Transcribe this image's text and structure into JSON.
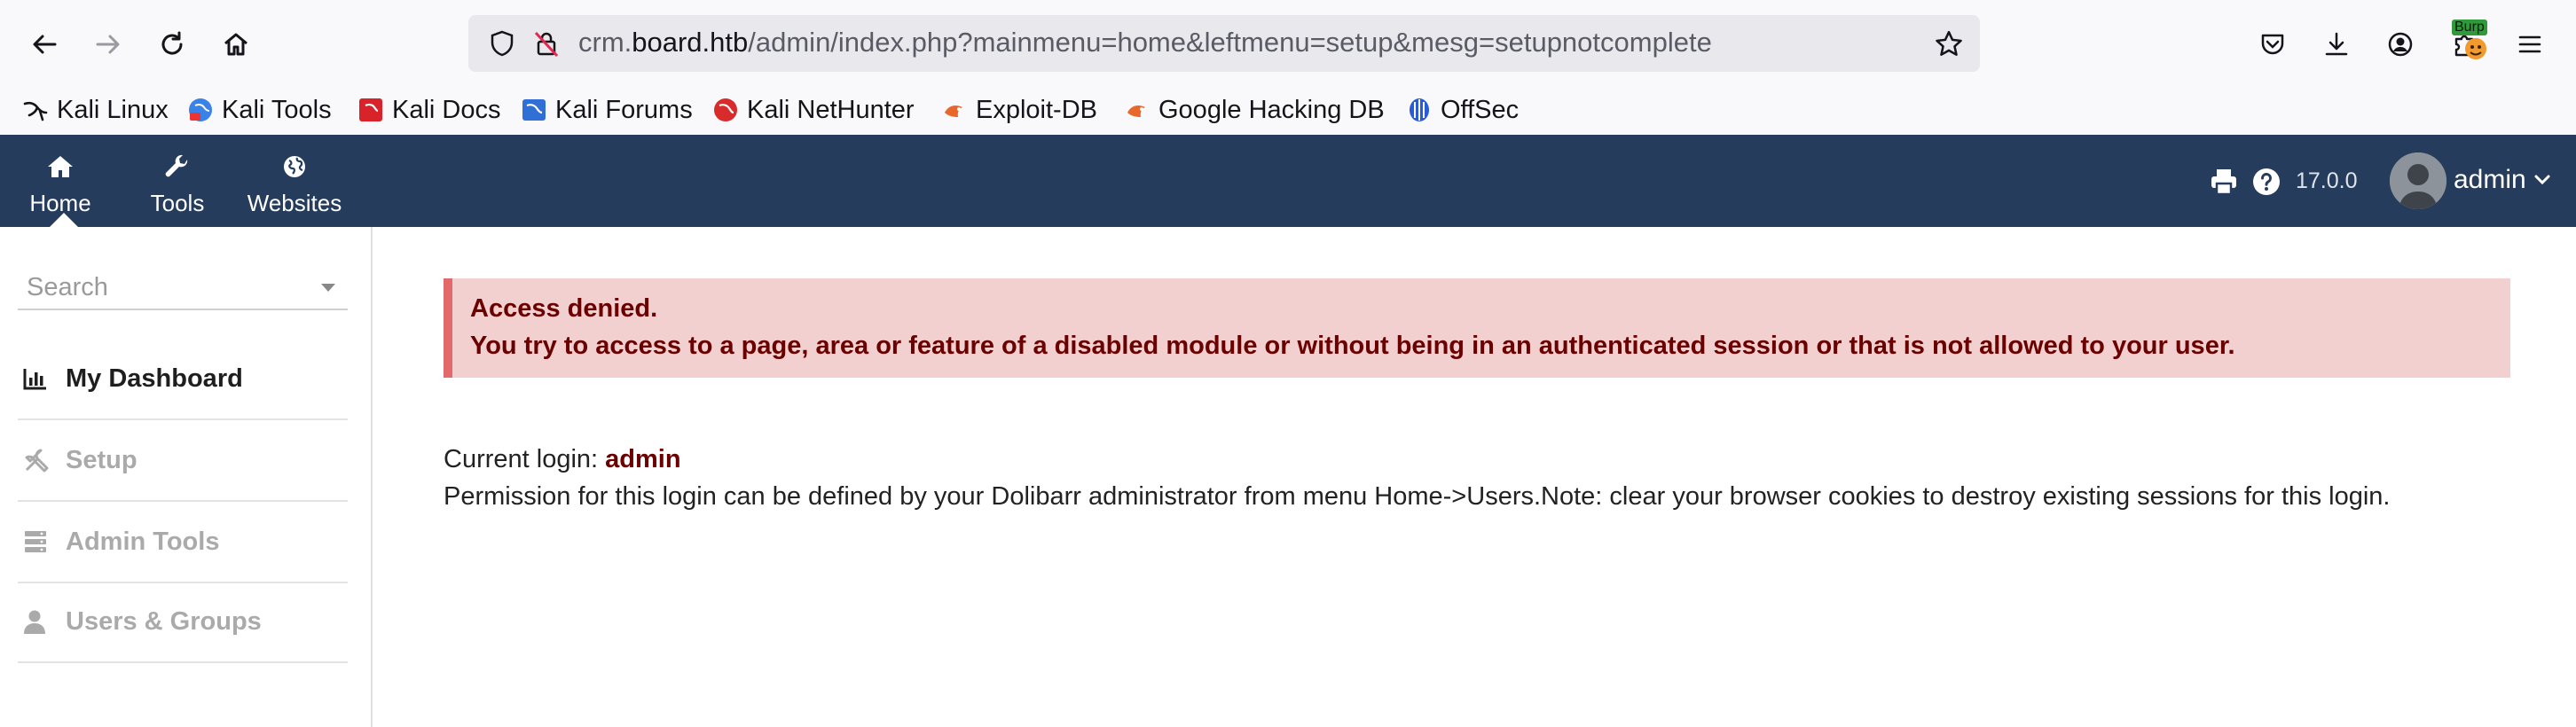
{
  "browser": {
    "url": {
      "prefix": "crm.",
      "host": "board.htb",
      "path": "/admin/index.php?mainmenu=home&leftmenu=setup&mesg=setupnotcomplete"
    },
    "extension_badge": "Burp"
  },
  "bookmarks": [
    {
      "label": "Kali Linux",
      "icon": "kali-dragon-icon"
    },
    {
      "label": "Kali Tools",
      "icon": "kali-tools-icon"
    },
    {
      "label": "Kali Docs",
      "icon": "kali-docs-icon"
    },
    {
      "label": "Kali Forums",
      "icon": "kali-forums-icon"
    },
    {
      "label": "Kali NetHunter",
      "icon": "kali-nethunter-icon"
    },
    {
      "label": "Exploit-DB",
      "icon": "exploit-db-icon"
    },
    {
      "label": "Google Hacking DB",
      "icon": "ghdb-icon"
    },
    {
      "label": "OffSec",
      "icon": "offsec-icon"
    }
  ],
  "topbar": {
    "items": [
      {
        "label": "Home",
        "icon": "home-icon"
      },
      {
        "label": "Tools",
        "icon": "wrench-icon"
      },
      {
        "label": "Websites",
        "icon": "globe-icon"
      }
    ],
    "version": "17.0.0",
    "user": "admin"
  },
  "sidebar": {
    "search_placeholder": "Search",
    "items": [
      {
        "label": "My Dashboard",
        "icon": "chart-bar-icon",
        "active": true
      },
      {
        "label": "Setup",
        "icon": "tools-icon",
        "active": false
      },
      {
        "label": "Admin Tools",
        "icon": "server-icon",
        "active": false
      },
      {
        "label": "Users & Groups",
        "icon": "user-icon",
        "active": false
      }
    ]
  },
  "main": {
    "alert_title": "Access denied.",
    "alert_message": "You try to access to a page, area or feature of a disabled module or without being in an authenticated session or that is not allowed to your user.",
    "login_label": "Current login: ",
    "login_user": "admin",
    "permission_text": "Permission for this login can be defined by your Dolibarr administrator from menu Home->Users.Note: clear your browser cookies to destroy existing sessions for this login."
  },
  "colors": {
    "topbar_bg": "#263c5c",
    "alert_bg": "#f2d0d0",
    "alert_border": "#e26a6a",
    "alert_text": "#6b0000"
  }
}
